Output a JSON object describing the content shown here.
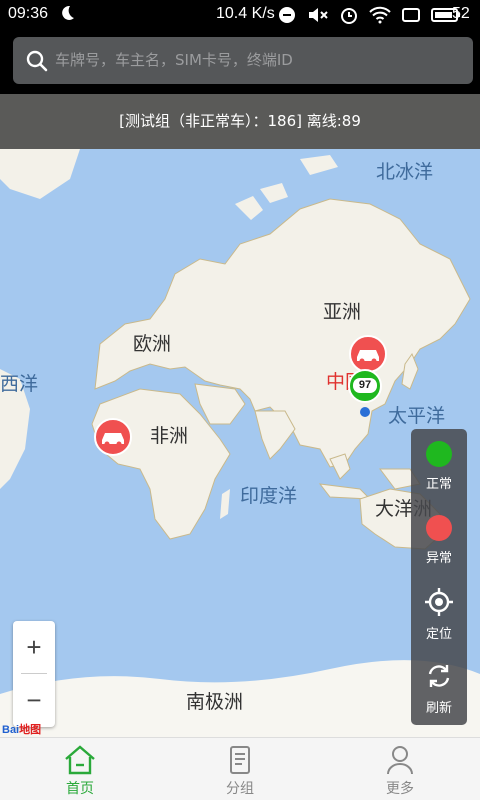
{
  "status_bar": {
    "time": "09:36",
    "net_speed": "10.4 K/s",
    "battery": "52"
  },
  "search": {
    "placeholder": "车牌号，车主名，SIM卡号，终端ID"
  },
  "info_banner": "[测试组（非正常车）：186]  离线:89",
  "map": {
    "labels": {
      "arctic": "北冰洋",
      "asia": "亚洲",
      "europe": "欧洲",
      "atlantic": "西洋",
      "china": "中国",
      "pacific": "太平洋",
      "africa": "非洲",
      "indian": "印度洋",
      "oceania": "大洋洲",
      "antarctica": "南极洲"
    },
    "cluster_count": "97",
    "zoom_in": "+",
    "zoom_out": "−",
    "logo_a": "Bai",
    "logo_b": "地图"
  },
  "side_panel": {
    "normal": "正常",
    "abnormal": "异常",
    "locate": "定位",
    "refresh": "刷新"
  },
  "colors": {
    "normal": "#1fb81f",
    "abnormal": "#f05050",
    "active_tab": "#2aa93a"
  },
  "bottom_nav": {
    "home": "首页",
    "group": "分组",
    "more": "更多"
  }
}
